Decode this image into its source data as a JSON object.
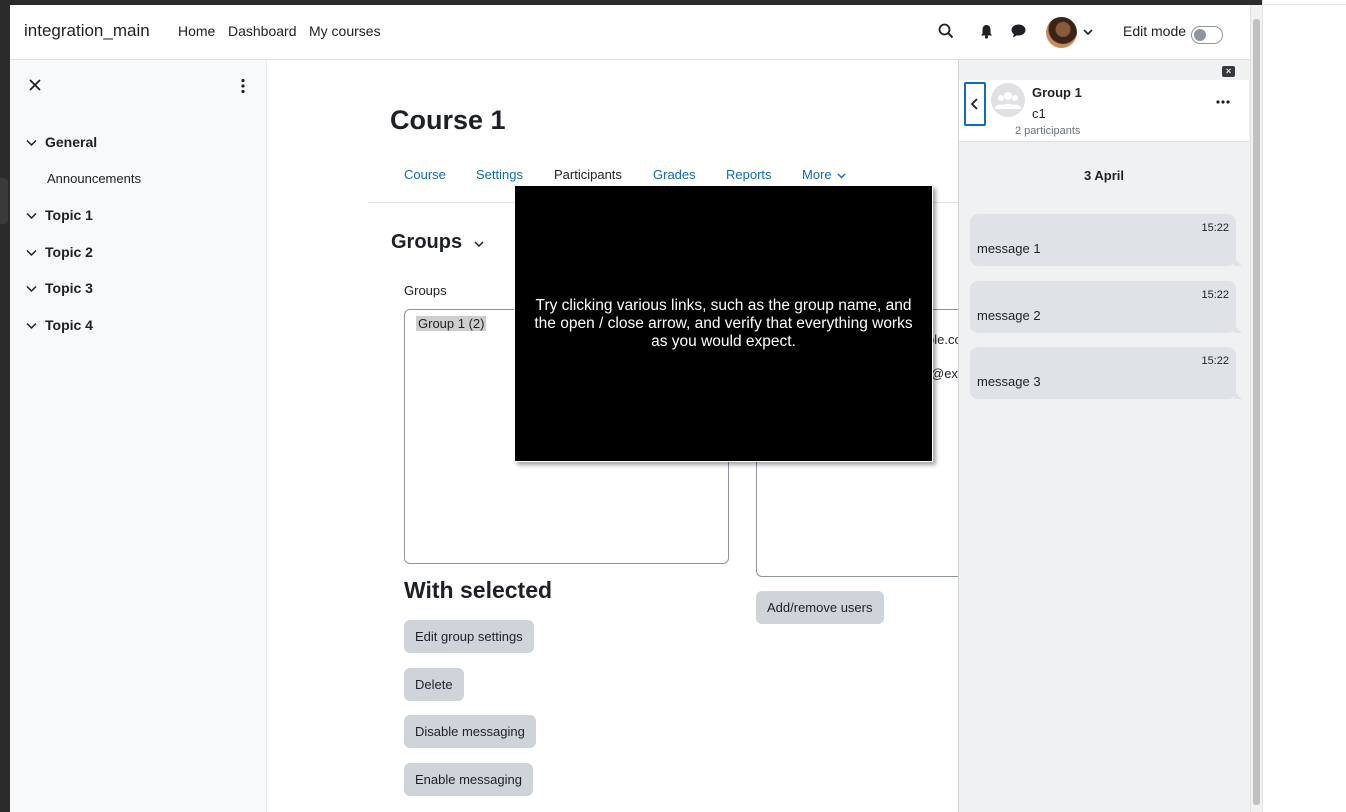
{
  "navbar": {
    "brand": "integration_main",
    "links": [
      "Home",
      "Dashboard",
      "My courses"
    ],
    "icons": [
      "search-icon",
      "bell-icon",
      "chat-icon",
      "chevron-down-icon"
    ],
    "edit_mode_label": "Edit mode",
    "edit_mode_on": false
  },
  "course_index": {
    "sections": [
      {
        "title": "General",
        "items": [
          "Announcements"
        ]
      },
      {
        "title": "Topic 1",
        "items": []
      },
      {
        "title": "Topic 2",
        "items": []
      },
      {
        "title": "Topic 3",
        "items": []
      },
      {
        "title": "Topic 4",
        "items": []
      }
    ]
  },
  "main": {
    "course_title": "Course 1",
    "tabs": [
      "Course",
      "Settings",
      "Participants",
      "Grades",
      "Reports",
      "More"
    ],
    "groups_heading": "Groups",
    "groups_label": "Groups",
    "group_options": [
      "Group 1 (2)"
    ],
    "members_partial": [
      "ple.co",
      "@ex"
    ],
    "with_selected_heading": "With selected",
    "buttons": {
      "edit_group_settings": "Edit group settings",
      "delete": "Delete",
      "disable_messaging": "Disable messaging",
      "enable_messaging": "Enable messaging",
      "add_remove_users": "Add/remove users"
    }
  },
  "tour": {
    "text": "Try clicking various links, such as the group name, and the open / close arrow, and verify that everything works as you would expect."
  },
  "messages": {
    "close_label": "×",
    "conversation_name": "Group 1",
    "course_name": "c1",
    "participants": "2 participants",
    "date": "3 April",
    "items": [
      {
        "time": "15:22",
        "text": "message 1"
      },
      {
        "time": "15:22",
        "text": "message 2"
      },
      {
        "time": "15:22",
        "text": "message 3"
      }
    ]
  }
}
